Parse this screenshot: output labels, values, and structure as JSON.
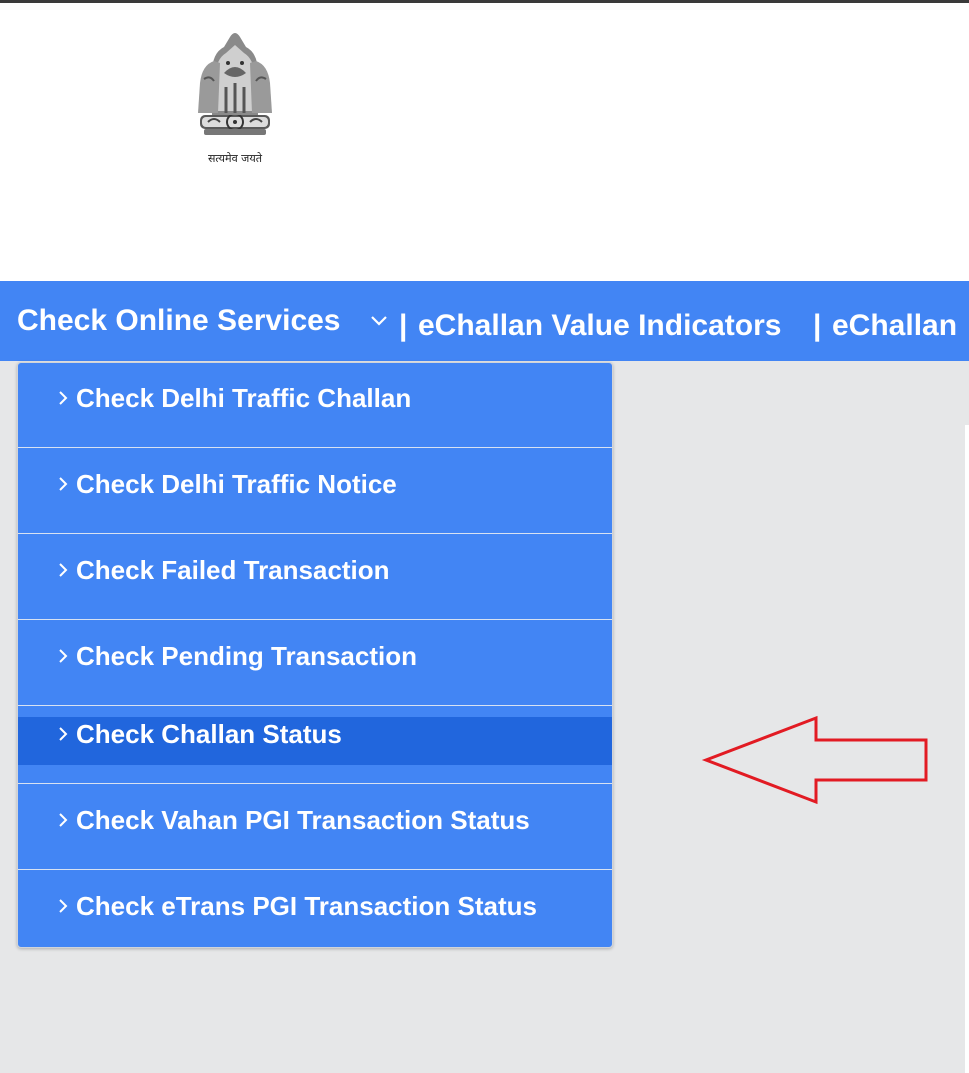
{
  "header": {
    "emblem_motto": "सत्यमेव जयते"
  },
  "nav": {
    "services_label": "Check Online Services",
    "separator": "|",
    "value_indicators_label": "eChallan Value Indicators",
    "echallan_label": "eChallan"
  },
  "dropdown": {
    "items": [
      {
        "label": "Check Delhi Traffic Challan"
      },
      {
        "label": "Check Delhi Traffic Notice"
      },
      {
        "label": "Check Failed Transaction"
      },
      {
        "label": "Check Pending Transaction"
      },
      {
        "label": "Check Challan Status",
        "active": true
      },
      {
        "label": "Check Vahan PGI Transaction Status"
      },
      {
        "label": "Check eTrans PGI Transaction Status"
      }
    ]
  },
  "colors": {
    "nav_blue": "#4285f4",
    "active_blue": "#2166dd",
    "annotation_red": "#e21b23",
    "page_bg": "#e6e7e8"
  },
  "icons": {
    "emblem": "national-emblem-icon",
    "nav_chevron": "chevron-down-icon",
    "item_chevron": "chevron-right-icon",
    "annotation": "red-arrow-left"
  }
}
